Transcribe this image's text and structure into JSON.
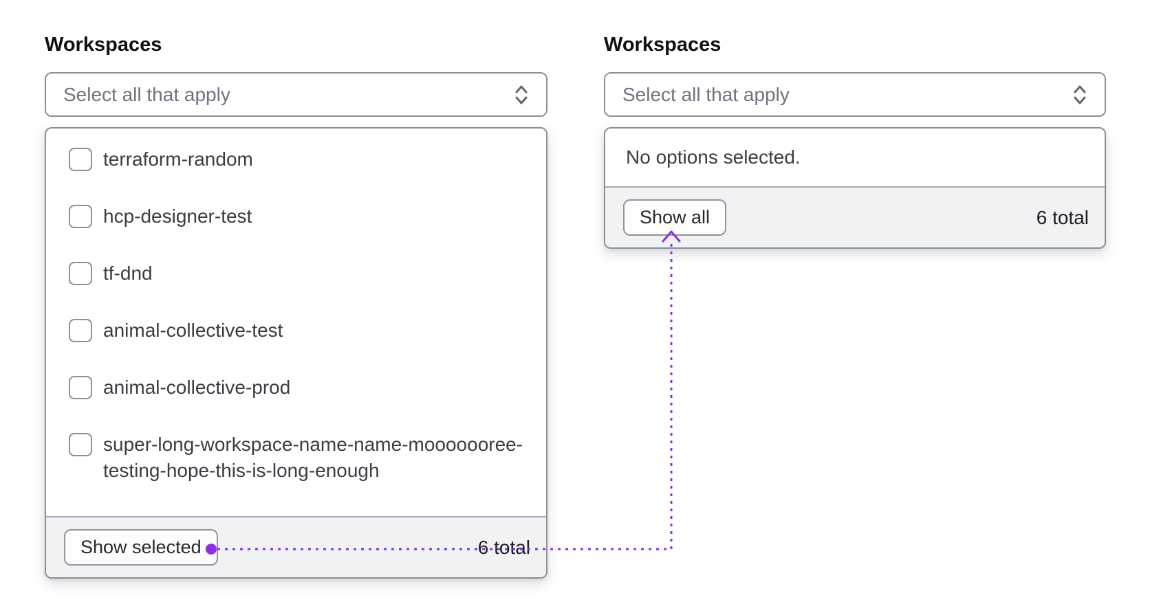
{
  "left_panel": {
    "label": "Workspaces",
    "select_placeholder": "Select all that apply",
    "options": [
      "terraform-random",
      "hcp-designer-test",
      "tf-dnd",
      "animal-collective-test",
      "animal-collective-prod",
      "super-long-workspace-name-name-mooooooree-testing-hope-this-is-long-enough"
    ],
    "footer": {
      "button": "Show selected",
      "total": "6 total"
    }
  },
  "right_panel": {
    "label": "Workspaces",
    "select_placeholder": "Select all that apply",
    "empty_message": "No options selected.",
    "footer": {
      "button": "Show all",
      "total": "6 total"
    }
  },
  "icons": {
    "select_caret": "caret-sort-icon",
    "annotation": "dotted-connector-arrow"
  },
  "colors": {
    "annotation_purple": "#8e2fe5",
    "border_gray": "#8a9099",
    "footer_bg": "#f1f2f4"
  }
}
